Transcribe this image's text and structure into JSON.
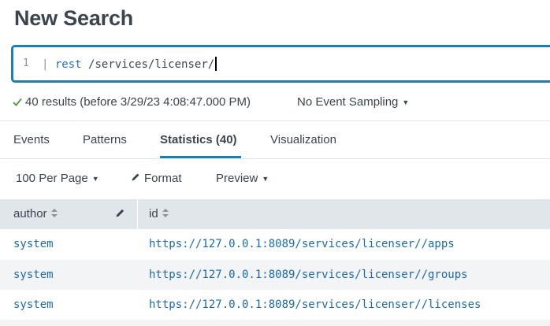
{
  "page": {
    "title": "New Search"
  },
  "search": {
    "line_number": "1",
    "pipe": "|",
    "command": "rest",
    "argument": "/services/licenser/"
  },
  "status": {
    "results_text": "40 results (before 3/29/23 4:08:47.000 PM)",
    "sampling_label": "No Event Sampling"
  },
  "tabs": [
    {
      "label": "Events"
    },
    {
      "label": "Patterns"
    },
    {
      "label": "Statistics (40)"
    },
    {
      "label": "Visualization"
    }
  ],
  "toolbar": {
    "per_page": "100 Per Page",
    "format": "Format",
    "preview": "Preview"
  },
  "table": {
    "columns": [
      "author",
      "id"
    ],
    "rows": [
      {
        "author": "system",
        "id": "https://127.0.0.1:8089/services/licenser//apps"
      },
      {
        "author": "system",
        "id": "https://127.0.0.1:8089/services/licenser//groups"
      },
      {
        "author": "system",
        "id": "https://127.0.0.1:8089/services/licenser//licenses"
      }
    ]
  },
  "colors": {
    "accent": "#1a7fb7",
    "link": "#1a6ba8",
    "success": "#4d9a3b",
    "header_bg": "#e1e6eb"
  }
}
